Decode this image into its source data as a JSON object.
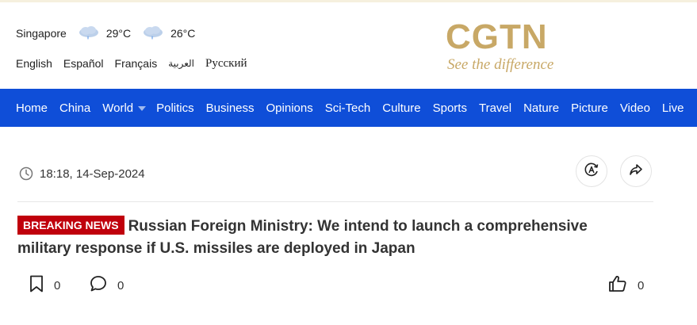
{
  "weather": {
    "city": "Singapore",
    "temp_1": "29°C",
    "temp_2": "26°C"
  },
  "languages": [
    "English",
    "Español",
    "Français",
    "العربية",
    "Русский"
  ],
  "logo": {
    "word": "CGTN",
    "tagline": "See the difference"
  },
  "nav": {
    "items": [
      "Home",
      "China",
      "World",
      "Politics",
      "Business",
      "Opinions",
      "Sci-Tech",
      "Culture",
      "Sports",
      "Travel",
      "Nature",
      "Picture",
      "Video",
      "Live"
    ]
  },
  "article": {
    "datetime": "18:18, 14-Sep-2024",
    "badge": "BREAKING NEWS",
    "headline": "Russian Foreign Ministry: We intend to launch a comprehensive military response if U.S. missiles are deployed in Japan",
    "bookmark_count": "0",
    "comment_count": "0",
    "like_count": "0"
  },
  "colors": {
    "nav_bg": "#0f4ed8",
    "logo_gold": "#c8a866",
    "badge_red": "#c0000c"
  }
}
